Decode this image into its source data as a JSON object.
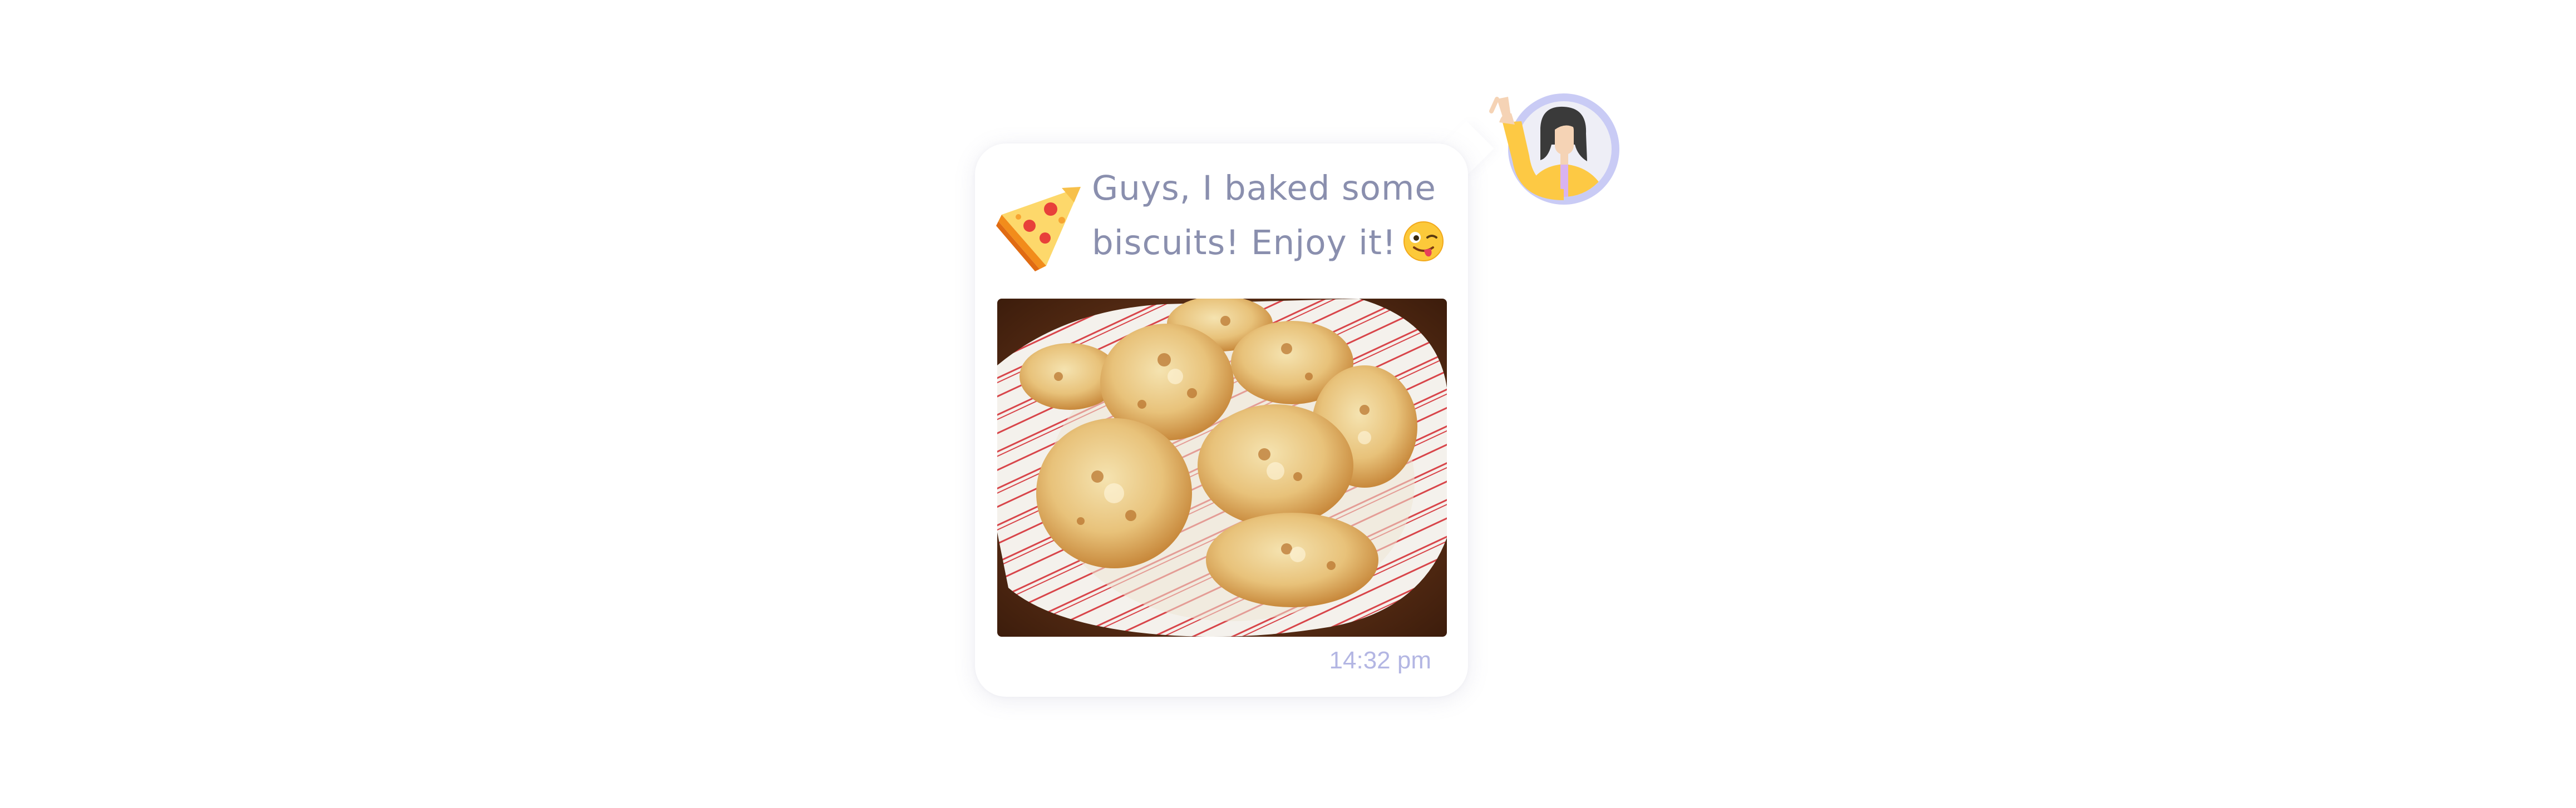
{
  "message": {
    "line1": "Guys, I baked some",
    "line2": "biscuits! Enjoy it!",
    "timestamp": "14:32 pm"
  },
  "icons": {
    "pizza": "pizza-emoji-icon",
    "wink": "winking-tongue-emoji-icon",
    "avatar": "waving-woman-avatar"
  },
  "colors": {
    "text": "#8a8fae",
    "timestamp": "#b3b6e3",
    "avatar_ring": "#c9cbf5",
    "avatar_shirt": "#fdc944"
  },
  "image": {
    "name": "biscuits-photo"
  }
}
